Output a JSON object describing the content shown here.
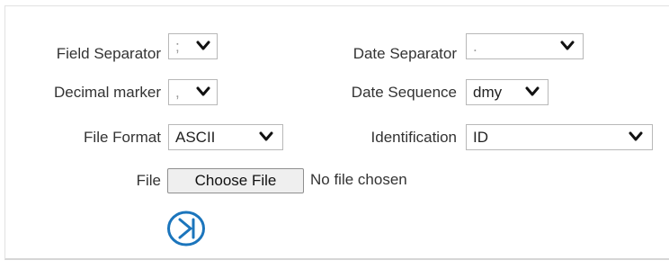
{
  "form": {
    "field_separator": {
      "label": "Field Separator",
      "value": ";"
    },
    "decimal_marker": {
      "label": "Decimal marker",
      "value": ","
    },
    "file_format": {
      "label": "File Format",
      "value": "ASCII"
    },
    "date_separator": {
      "label": "Date Separator",
      "value": "."
    },
    "date_sequence": {
      "label": "Date Sequence",
      "value": "dmy"
    },
    "identification": {
      "label": "Identification",
      "value": "ID"
    },
    "file": {
      "label": "File",
      "button_label": "Choose File",
      "status": "No file chosen"
    }
  },
  "icons": {
    "dropdown": "chevron-down-icon",
    "next": "skip-next-icon"
  },
  "colors": {
    "accent": "#1b75bc",
    "border": "#b8b8b8",
    "text": "#333333"
  }
}
